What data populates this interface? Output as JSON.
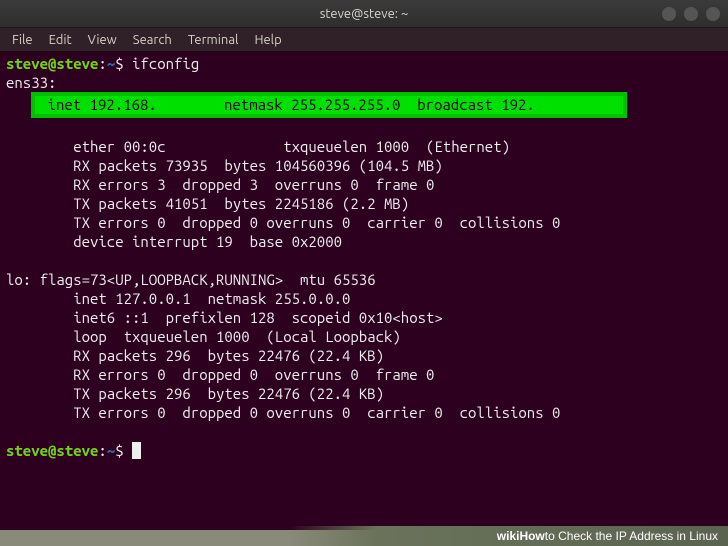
{
  "window": {
    "title": "steve@steve: ~"
  },
  "menubar": {
    "items": [
      "File",
      "Edit",
      "View",
      "Search",
      "Terminal",
      "Help"
    ]
  },
  "terminal": {
    "prompt_user": "steve@steve",
    "prompt_sep": ":",
    "prompt_path": "~",
    "prompt_symbol": "$ ",
    "command": "ifconfig",
    "ens33_head": "ens33:",
    "highlight_line": " inet 192.168.        netmask 255.255.255.0  broadcast 192.          ",
    "ens33_block": "        ether 00:0c              txqueuelen 1000  (Ethernet)\n        RX packets 73935  bytes 104560396 (104.5 MB)\n        RX errors 3  dropped 3  overruns 0  frame 0\n        TX packets 41051  bytes 2245186 (2.2 MB)\n        TX errors 0  dropped 0 overruns 0  carrier 0  collisions 0\n        device interrupt 19  base 0x2000",
    "lo_block": "lo: flags=73<UP,LOOPBACK,RUNNING>  mtu 65536\n        inet 127.0.0.1  netmask 255.0.0.0\n        inet6 ::1  prefixlen 128  scopeid 0x10<host>\n        loop  txqueuelen 1000  (Local Loopback)\n        RX packets 296  bytes 22476 (22.4 KB)\n        RX errors 0  dropped 0  overruns 0  frame 0\n        TX packets 296  bytes 22476 (22.4 KB)\n        TX errors 0  dropped 0 overruns 0  carrier 0  collisions 0"
  },
  "footer": {
    "brand_prefix": "wiki",
    "brand_suffix": "How",
    "caption": " to Check the IP Address in Linux"
  }
}
